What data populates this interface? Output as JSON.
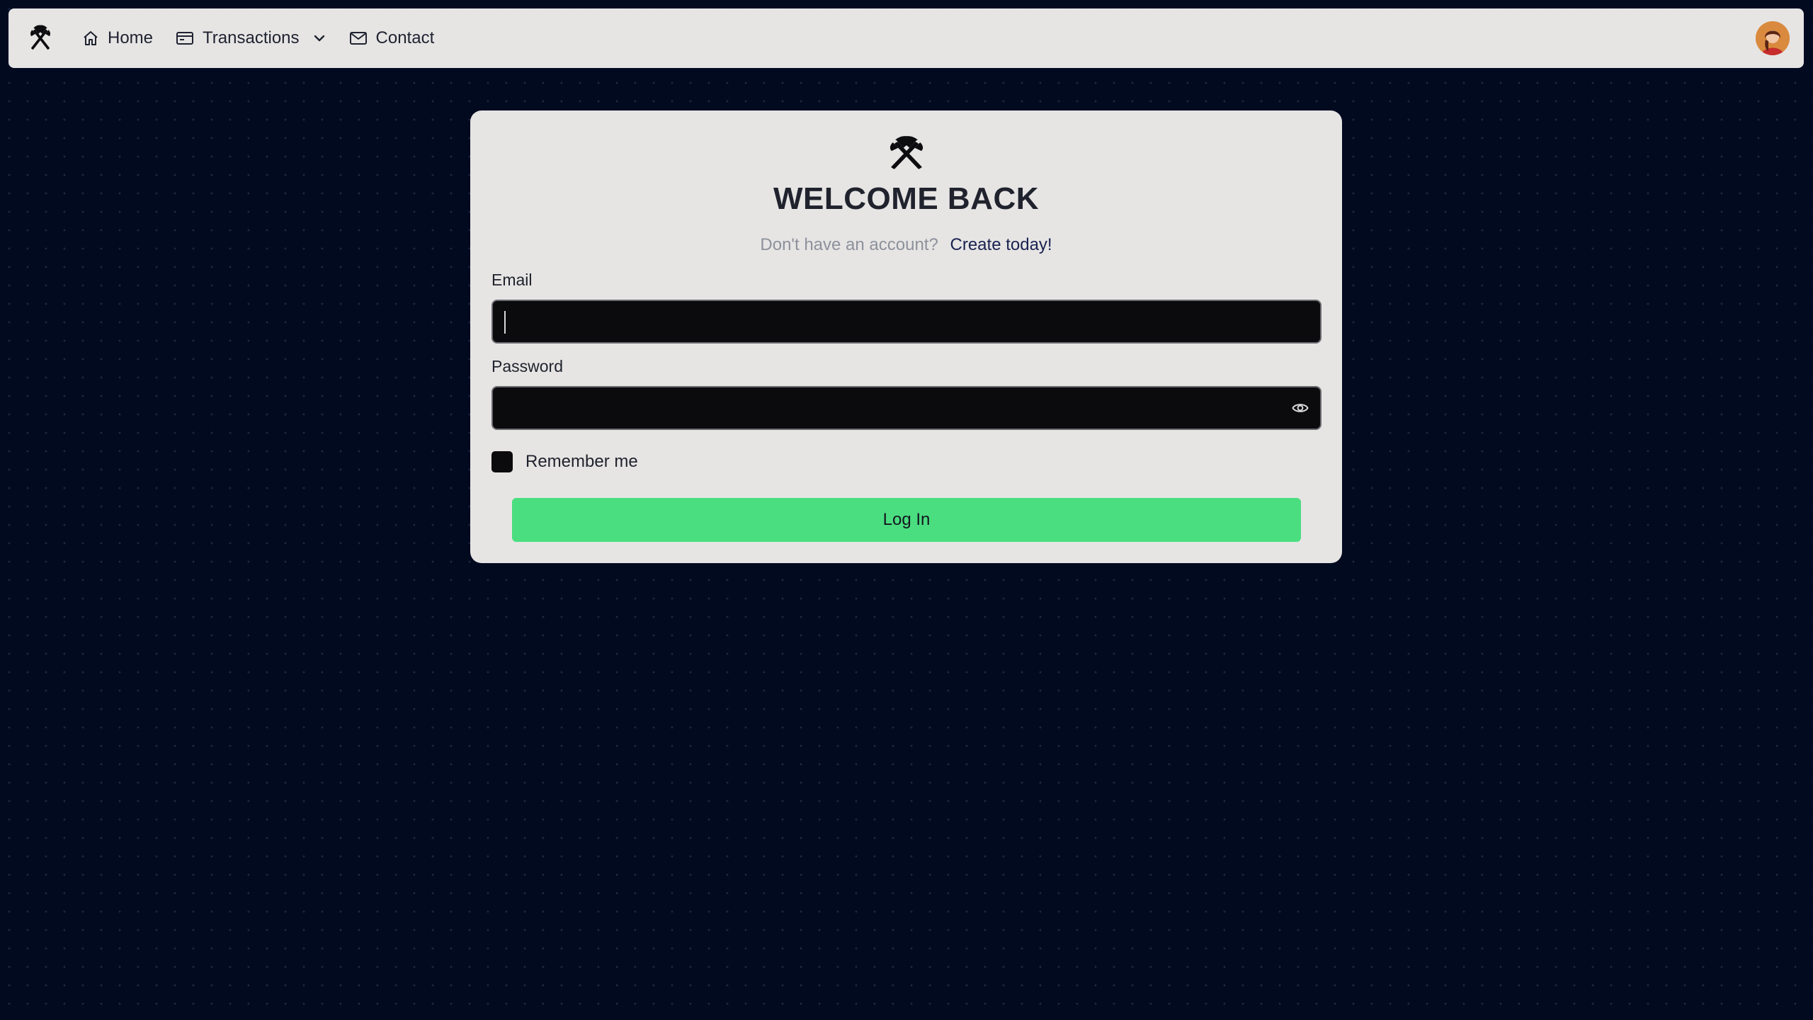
{
  "colors": {
    "background": "#020a20",
    "surface": "#e6e5e4",
    "input_bg": "#0b0b0d",
    "primary_button": "#4ade80",
    "link": "#1a2250",
    "muted_text": "#8d919b"
  },
  "navbar": {
    "logo_icon": "crossed-axes-icon",
    "items": [
      {
        "label": "Home",
        "icon": "home-icon"
      },
      {
        "label": "Transactions",
        "icon": "card-icon",
        "has_dropdown": true
      },
      {
        "label": "Contact",
        "icon": "mail-icon"
      }
    ],
    "avatar": "user-avatar"
  },
  "login": {
    "logo_icon": "crossed-axes-icon",
    "title": "WELCOME BACK",
    "signup_prompt": "Don't have an account?",
    "signup_link": "Create today!",
    "email_label": "Email",
    "email_value": "",
    "password_label": "Password",
    "password_value": "",
    "password_toggle_icon": "eye-icon",
    "remember_label": "Remember me",
    "remember_checked": false,
    "submit_label": "Log In"
  }
}
